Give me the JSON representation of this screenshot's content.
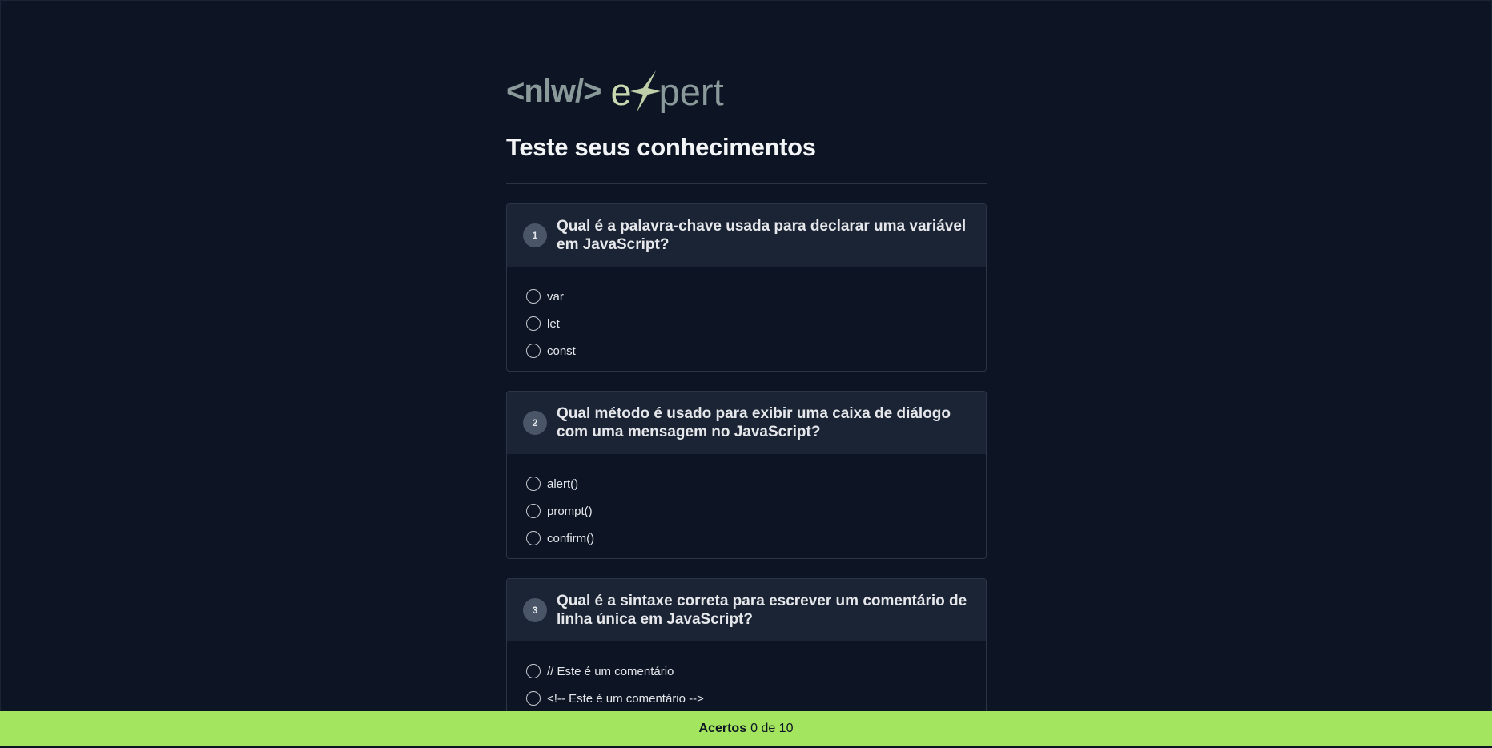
{
  "logo": {
    "nlw": "<nlw/>",
    "expert_e": "e",
    "expert_rest": "pert",
    "icon": "sparkle-icon"
  },
  "page_title": "Teste seus conhecimentos",
  "questions": [
    {
      "number": "1",
      "text": "Qual é a palavra-chave usada para declarar uma variável em JavaScript?",
      "options": [
        "var",
        "let",
        "const"
      ]
    },
    {
      "number": "2",
      "text": "Qual método é usado para exibir uma caixa de diálogo com uma mensagem no JavaScript?",
      "options": [
        "alert()",
        "prompt()",
        "confirm()"
      ]
    },
    {
      "number": "3",
      "text": "Qual é a sintaxe correta para escrever um comentário de linha única em JavaScript?",
      "options": [
        "// Este é um comentário",
        "<!-- Este é um comentário -->"
      ]
    }
  ],
  "footer": {
    "label": "Acertos",
    "score": "0 de 10"
  },
  "colors": {
    "background": "#0d1524",
    "card_header": "#1b2434",
    "footer": "#a3e55e",
    "logo_accent": "#c8d8b0"
  }
}
